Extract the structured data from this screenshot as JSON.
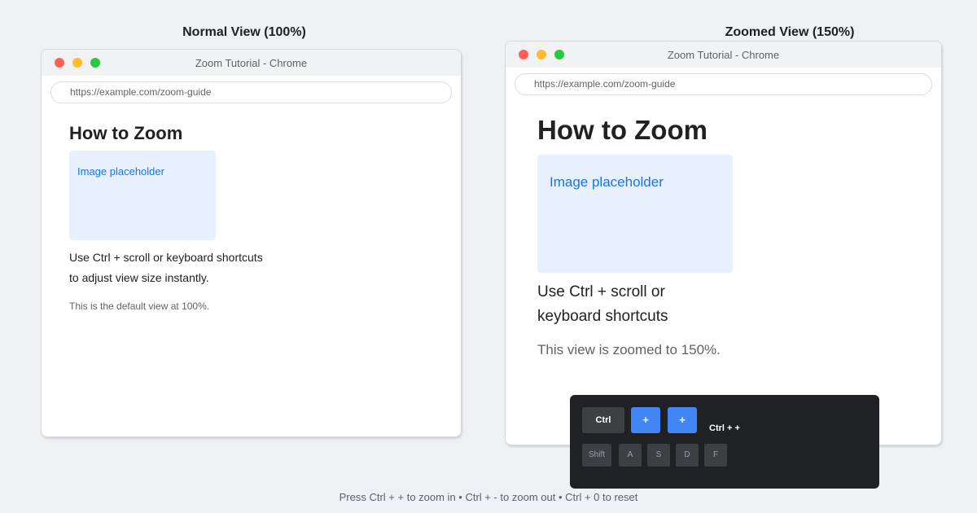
{
  "panels": {
    "left_title": "Normal View (100%)",
    "right_title": "Zoomed View (150%)"
  },
  "window_left": {
    "title": "Zoom Tutorial - Chrome",
    "url": "https://example.com/zoom-guide",
    "heading": "How to Zoom",
    "image_placeholder": "Image placeholder",
    "body_line1": "Use Ctrl + scroll or keyboard shortcuts",
    "body_line2": "to adjust view size instantly.",
    "note": "This is the default view at 100%."
  },
  "window_right": {
    "title": "Zoom Tutorial - Chrome",
    "url": "https://example.com/zoom-guide",
    "heading": "How to Zoom",
    "image_placeholder": "Image placeholder",
    "body_line1": "Use Ctrl + scroll or",
    "body_line2": "keyboard shortcuts",
    "note": "This view is zoomed to 150%."
  },
  "keyboard": {
    "ctrl": "Ctrl",
    "plus1": "+",
    "plus2": "+",
    "combo_label": "Ctrl + +",
    "row": [
      "Shift",
      "A",
      "S",
      "D",
      "F"
    ]
  },
  "footer": "Press Ctrl + + to zoom in • Ctrl + - to zoom out • Ctrl + 0 to reset",
  "colors": {
    "accent": "#4285f4",
    "image_bg": "#e8f0fe",
    "link_blue": "#1a73e8",
    "overlay_bg": "#202124"
  }
}
